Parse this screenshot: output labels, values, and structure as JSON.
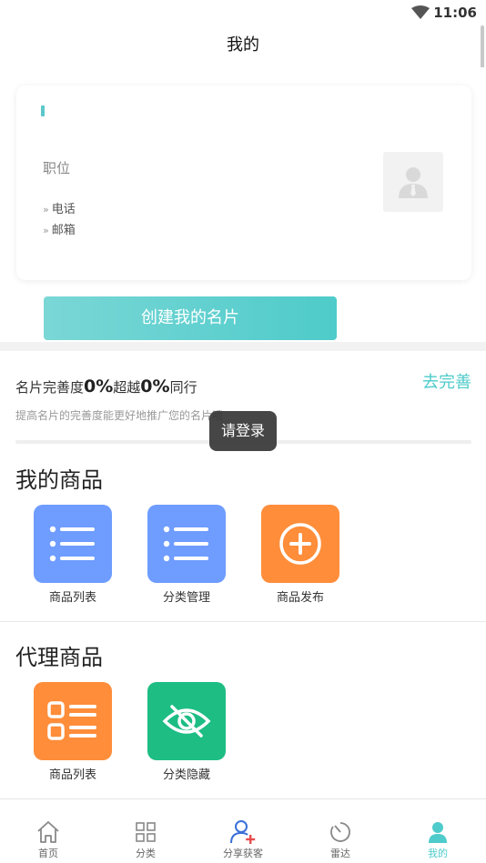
{
  "status_bar": {
    "time": "11:06"
  },
  "header": {
    "title": "我的"
  },
  "card": {
    "position_label": "职位",
    "phone_label": "电话",
    "email_label": "邮箱",
    "row_marker": "»"
  },
  "create_button": {
    "label": "创建我的名片"
  },
  "completeness": {
    "prefix": "名片完善度",
    "percent": "0%",
    "middle": "超越",
    "peer_percent": "0%",
    "suffix": "同行",
    "action": "去完善",
    "hint": "提高名片的完善度能更好地推广您的名片哦"
  },
  "toast": {
    "text": "请登录"
  },
  "my_products": {
    "title": "我的商品",
    "items": [
      {
        "label": "商品列表",
        "icon": "list-icon",
        "color": "#6e9cff"
      },
      {
        "label": "分类管理",
        "icon": "list-icon",
        "color": "#6e9cff"
      },
      {
        "label": "商品发布",
        "icon": "plus-circle-icon",
        "color": "#ff8d3a"
      }
    ]
  },
  "agent_products": {
    "title": "代理商品",
    "items": [
      {
        "label": "商品列表",
        "icon": "checklist-icon",
        "color": "#ff8d3a"
      },
      {
        "label": "分类隐藏",
        "icon": "eye-off-icon",
        "color": "#1dbd84"
      }
    ]
  },
  "tabbar": {
    "active_color": "#4ecbca",
    "items": [
      {
        "label": "首页",
        "icon": "home-icon"
      },
      {
        "label": "分类",
        "icon": "grid-icon"
      },
      {
        "label": "分享获客",
        "icon": "share-user-icon"
      },
      {
        "label": "雷达",
        "icon": "radar-icon"
      },
      {
        "label": "我的",
        "icon": "person-icon"
      }
    ]
  }
}
